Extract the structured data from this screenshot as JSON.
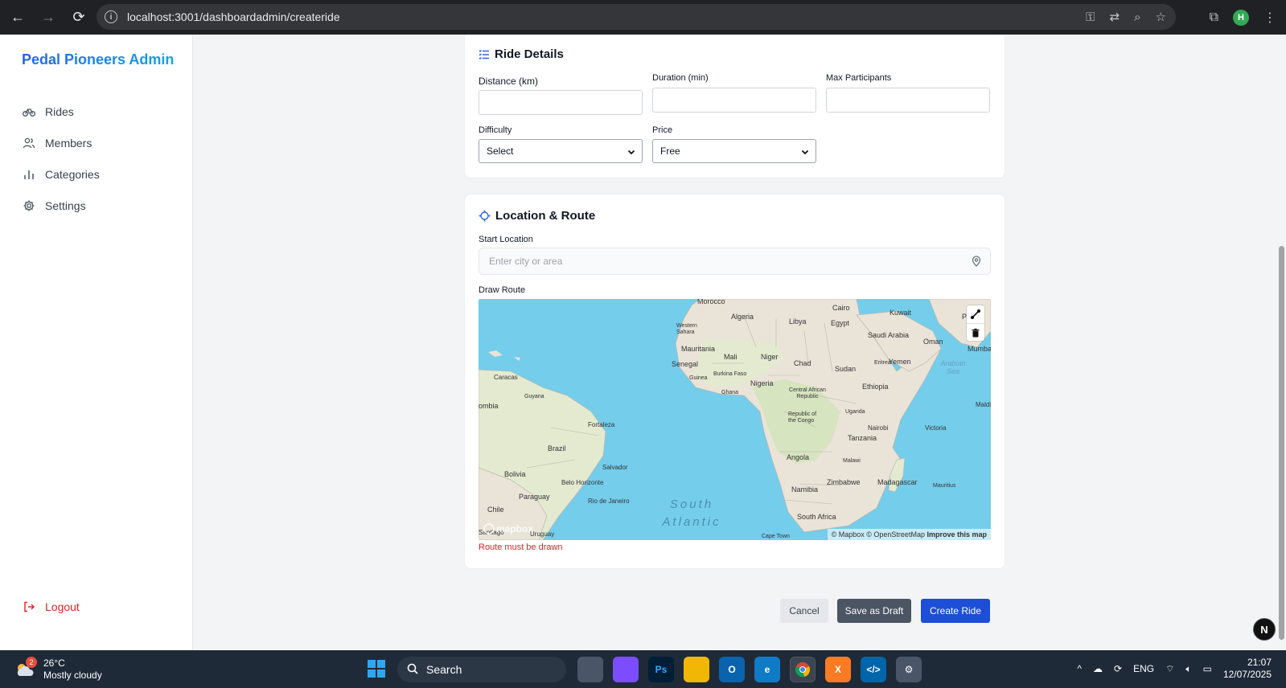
{
  "browser": {
    "url": "localhost:3001/dashboardadmin/createride"
  },
  "sidebar": {
    "brand": "Pedal Pioneers Admin",
    "items": [
      {
        "label": "Rides",
        "icon": "bike-icon"
      },
      {
        "label": "Members",
        "icon": "users-icon"
      },
      {
        "label": "Categories",
        "icon": "bar-chart-icon"
      },
      {
        "label": "Settings",
        "icon": "gear-icon"
      }
    ],
    "logout": "Logout"
  },
  "ride_details": {
    "title": "Ride Details",
    "distance_label": "Distance (km)",
    "duration_label": "Duration (min)",
    "max_participants_label": "Max Participants",
    "difficulty_label": "Difficulty",
    "difficulty_value": "Select",
    "price_label": "Price",
    "price_value": "Free"
  },
  "location": {
    "title": "Location & Route",
    "start_label": "Start Location",
    "start_placeholder": "Enter city or area",
    "route_label": "Draw Route",
    "error": "Route must be drawn",
    "map": {
      "labels": [
        "Morocco",
        "Algeria",
        "Libya",
        "Egypt",
        "Cairo",
        "Kuwait",
        "Pak",
        "Saudi Arabia",
        "Oman",
        "Mumbai",
        "Western Sahara",
        "Mauritania",
        "Mali",
        "Niger",
        "Chad",
        "Sudan",
        "Eritrea",
        "Yemen",
        "Arabian Sea",
        "Senegal",
        "Guinea",
        "Burkina Faso",
        "Nigeria",
        "Ghana",
        "Ethiopia",
        "Caracas",
        "Guyana",
        "ombia",
        "Central African Republic",
        "Republic of the Congo",
        "Uganda",
        "Nairobi",
        "Tanzania",
        "Victoria",
        "Maldi",
        "Fortaleza",
        "Brazil",
        "Salvador",
        "Bolivia",
        "Belo Horizonte",
        "Angola",
        "Malawi",
        "Zimbabwe",
        "Madagascar",
        "Mauritius",
        "Namibia",
        "Paraguay",
        "Rio de Janeiro",
        "Chile",
        "Santiago",
        "Uruguay",
        "South Africa",
        "Cape Town"
      ],
      "ocean": "South Atlantic",
      "logo": "mapbox",
      "attribution_mapbox": "© Mapbox",
      "attribution_osm": "© OpenStreetMap",
      "attribution_improve": "Improve this map"
    }
  },
  "actions": {
    "cancel": "Cancel",
    "draft": "Save as Draft",
    "create": "Create Ride"
  },
  "dev_badge": "N",
  "taskbar": {
    "weather_temp": "26°C",
    "weather_desc": "Mostly cloudy",
    "weather_badge": "2",
    "search": "Search",
    "lang": "ENG",
    "time": "21:07",
    "date": "12/07/2025"
  },
  "colors": {
    "accent": "#2563eb",
    "create_button": "#1d4ed8",
    "draft_button": "#4b5563",
    "error": "#dc2626",
    "ocean": "#74cdeb",
    "land": "#eae4d8"
  }
}
